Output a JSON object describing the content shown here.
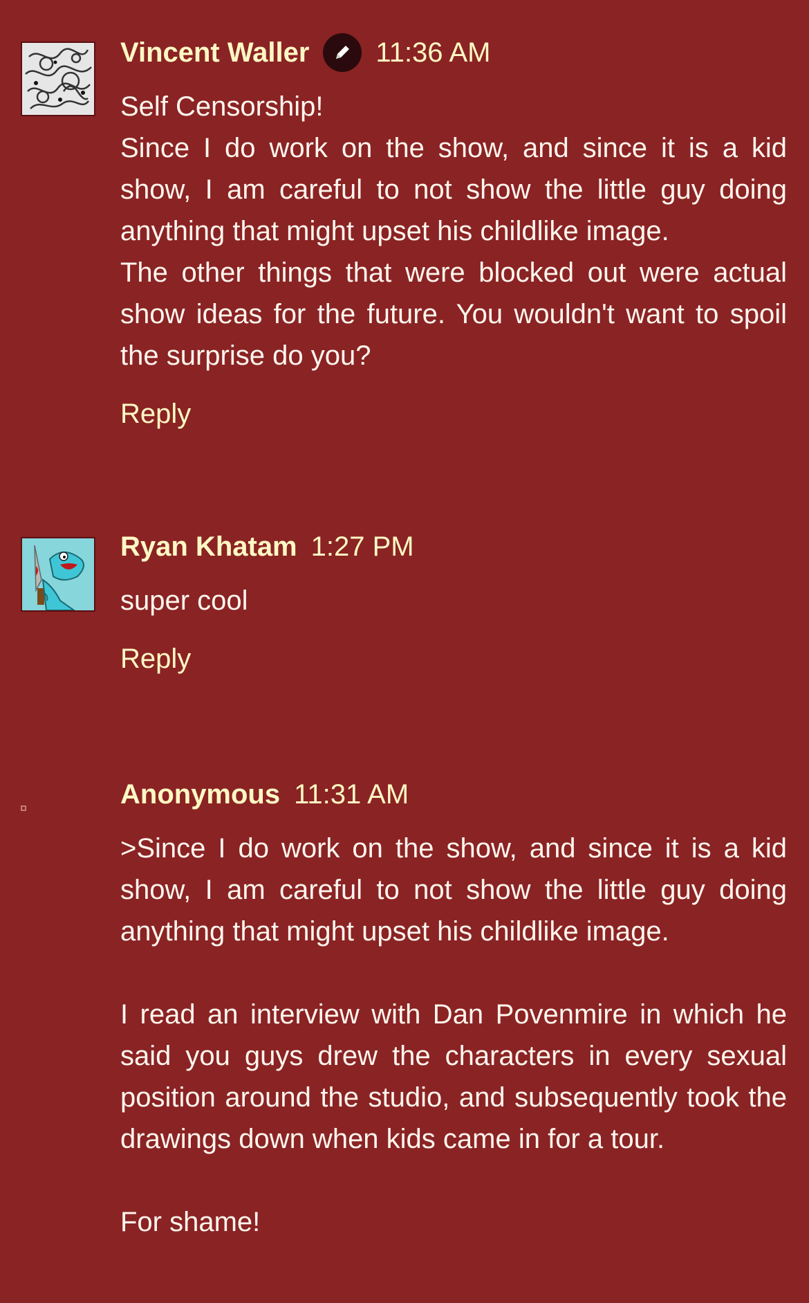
{
  "comments": [
    {
      "author": "Vincent Waller",
      "blog_author_icon": "pencil-icon",
      "timestamp": "11:36 AM",
      "paragraphs": [
        "Self Censorship!",
        "Since I do work on the show, and since it is a kid show, I am careful to not show the little guy doing anything that might upset his childlike image.",
        "The other things that were blocked out were actual show ideas for the future. You wouldn't want to spoil the surprise do you?"
      ],
      "reply_label": "Reply"
    },
    {
      "author": "Ryan Khatam",
      "timestamp": "1:27 PM",
      "paragraphs": [
        "super cool"
      ],
      "reply_label": "Reply"
    },
    {
      "author": "Anonymous",
      "timestamp": "11:31 AM",
      "paragraphs": [
        ">Since I do work on the show, and since it is a kid show, I am careful to not show the little guy doing anything that might upset his childlike image.",
        "I read an interview with Dan Povenmire in which he said you guys drew the characters in every sexual position around the studio, and subsequently took the drawings down when kids came in for a tour.",
        "For shame!"
      ]
    }
  ],
  "colors": {
    "background": "#8a2324",
    "author_text": "#fff8c4",
    "body_text": "#fff6ee"
  }
}
